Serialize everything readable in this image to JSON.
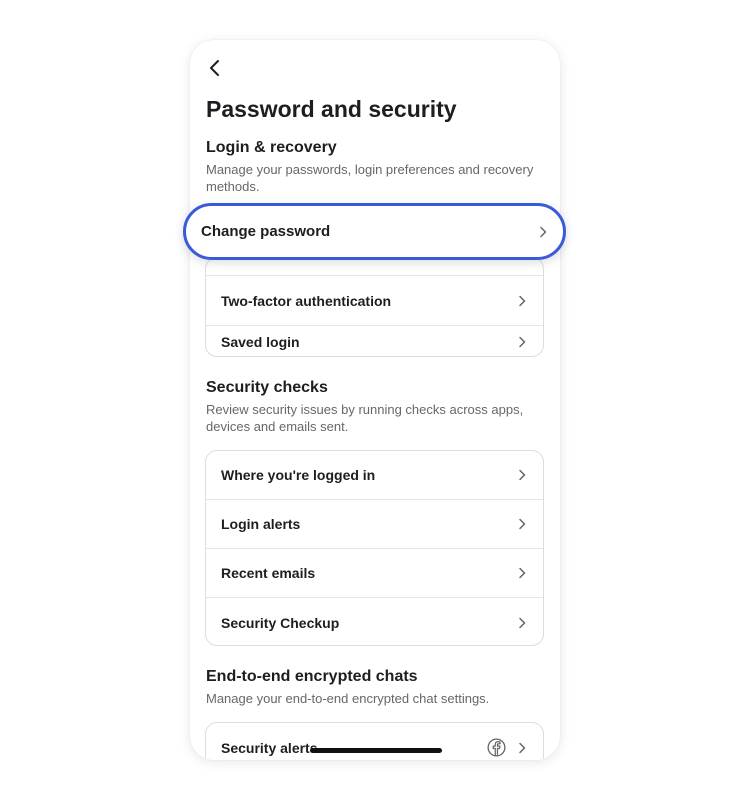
{
  "page": {
    "title": "Password and security",
    "back_icon": "back-arrow-icon"
  },
  "login_recovery": {
    "title": "Login & recovery",
    "description": "Manage your passwords, login preferences and recovery methods.",
    "items": [
      {
        "label": "Change password"
      },
      {
        "label": "Two-factor authentication"
      },
      {
        "label": "Saved login"
      }
    ]
  },
  "security_checks": {
    "title": "Security checks",
    "description": "Review security issues by running checks across apps, devices and emails sent.",
    "items": [
      {
        "label": "Where you're logged in"
      },
      {
        "label": "Login alerts"
      },
      {
        "label": "Recent emails"
      },
      {
        "label": "Security Checkup"
      }
    ]
  },
  "e2e_chats": {
    "title": "End-to-end encrypted chats",
    "description": "Manage your end-to-end encrypted chat settings.",
    "items": [
      {
        "label": "Security alerts",
        "icon": "facebook-icon"
      }
    ]
  },
  "colors": {
    "highlight_border": "#3a5ad9",
    "text_primary": "#1c1e21",
    "text_secondary": "#65676b",
    "card_border": "#dadde1"
  }
}
